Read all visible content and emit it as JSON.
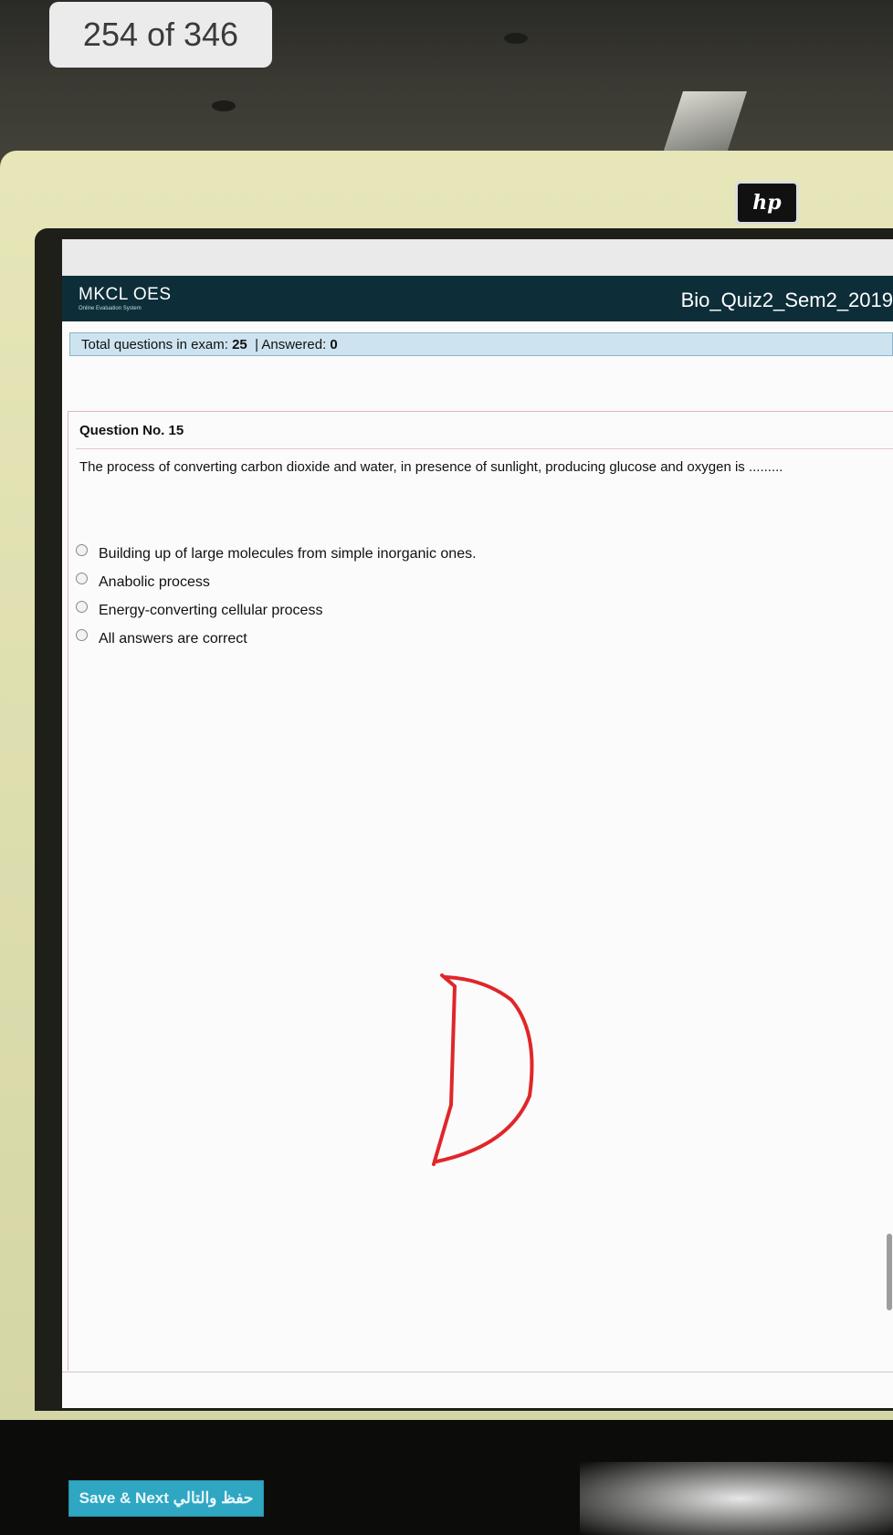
{
  "viewer": {
    "counter": "254 of 346"
  },
  "monitor": {
    "logo_text": "hp"
  },
  "app": {
    "brand": "MKCL OES",
    "brand_sub": "Online Evaluation System",
    "exam_title": "Bio_Quiz2_Sem2_2019"
  },
  "status": {
    "total_label": "Total questions in exam:",
    "total_value": "25",
    "answered_label": "| Answered:",
    "answered_value": "0"
  },
  "question": {
    "title": "Question No. 15",
    "text": "The process of converting carbon dioxide and water, in presence of sunlight, producing glucose and oxygen is .........",
    "options": [
      {
        "label": "Building up of large molecules from simple inorganic ones."
      },
      {
        "label": "Anabolic process"
      },
      {
        "label": "Energy-converting cellular process"
      },
      {
        "label": "All answers are correct"
      }
    ]
  },
  "actions": {
    "save_next": "Save & Next حفظ والتالي"
  },
  "annotation": {
    "color": "#e0262a"
  }
}
